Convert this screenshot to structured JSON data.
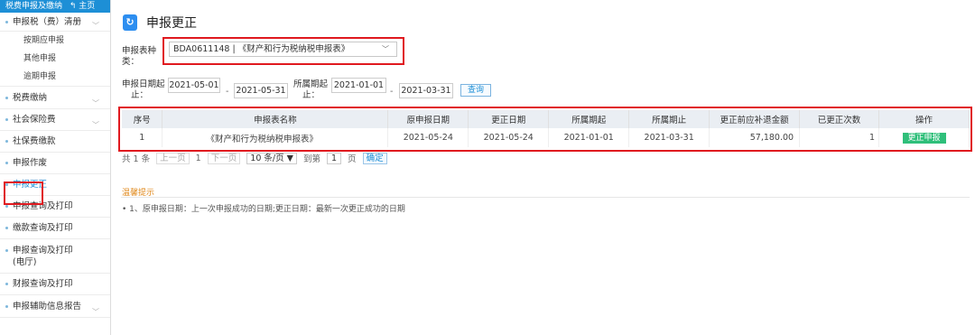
{
  "sidebar": {
    "header": "税费申报及缴纳",
    "home": "主页",
    "items": [
      {
        "label": "申报税（费）清册",
        "chev": true
      },
      {
        "label": "按期应申报",
        "sub": true
      },
      {
        "label": "其他申报",
        "sub": true
      },
      {
        "label": "逾期申报",
        "sub": true
      },
      {
        "label": "税费缴纳",
        "chev": true
      },
      {
        "label": "社会保险费",
        "chev": true
      },
      {
        "label": "社保费缴款"
      },
      {
        "label": "申报作废"
      },
      {
        "label": "申报更正",
        "active": true
      },
      {
        "label": "申报查询及打印"
      },
      {
        "label": "缴款查询及打印"
      },
      {
        "label": "申报查询及打印",
        "label2": "(电厅)"
      },
      {
        "label": "财报查询及打印"
      },
      {
        "label": "申报辅助信息报告",
        "chev": true
      }
    ]
  },
  "page": {
    "title": "申报更正",
    "title_icon": "refresh-doc-icon"
  },
  "form": {
    "report_type_label1": "申报表种",
    "report_type_label2": "类：",
    "report_type_value": "BDA0611148 | 《财产和行为税纳税申报表》",
    "report_date_label1": "申报日期起",
    "report_date_label2": "止：",
    "report_date_start": "2021-05-01",
    "report_date_end": "2021-05-31",
    "period_label1": "所属期起",
    "period_label2": "止：",
    "period_start": "2021-01-01",
    "period_end": "2021-03-31",
    "dash": "-",
    "query_button": "查询"
  },
  "table": {
    "columns": [
      "序号",
      "申报表名称",
      "原申报日期",
      "更正日期",
      "所属期起",
      "所属期止",
      "更正前应补退金额",
      "已更正次数",
      "操作"
    ],
    "rows": [
      [
        "1",
        "《财产和行为税纳税申报表》",
        "2021-05-24",
        "2021-05-24",
        "2021-01-01",
        "2021-03-31",
        "57,180.00",
        "1",
        "更正申报"
      ]
    ]
  },
  "pager": {
    "total": "共 1 条",
    "prev": "上一页",
    "page": "1",
    "next": "下一页",
    "page_size": "10 条/页 ▼",
    "goto_label": "到第",
    "goto_value": "1",
    "page_unit": "页",
    "confirm": "确定"
  },
  "tips": {
    "title": "温馨提示",
    "text": "• 1、原申报日期：上一次申报成功的日期;更正日期：最新一次更正成功的日期"
  },
  "colors": {
    "accent": "#1d8fd6",
    "highlight": "#e0191f",
    "action": "#2fbf7a",
    "tip": "#e08a1e"
  }
}
